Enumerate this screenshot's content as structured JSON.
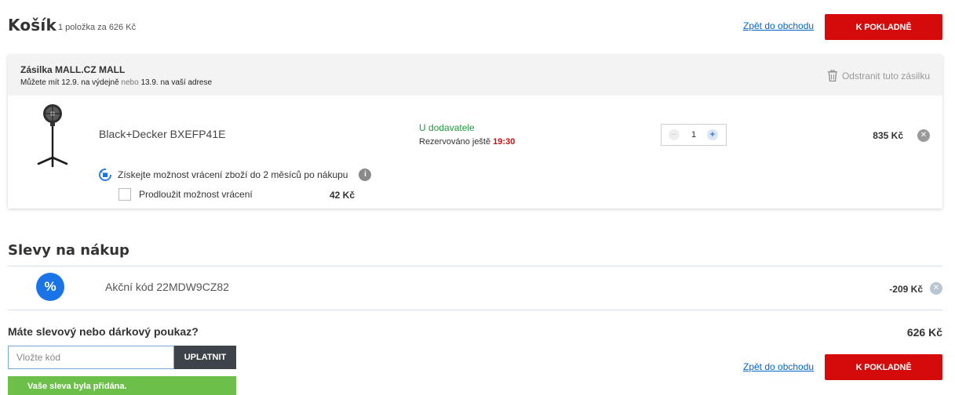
{
  "header": {
    "title": "Košík",
    "summary": "1 položka za 626 Kč",
    "back_link": "Zpět do obchodu",
    "checkout_label": "K POKLADNĚ"
  },
  "shipment": {
    "title": "Zásilka MALL.CZ MALL",
    "delivery_prefix": "Můžete mít 12.9. na výdejně",
    "delivery_or": "nebo",
    "delivery_suffix": "13.9. na vaší adrese",
    "remove_label": "Odstranit tuto zásilku",
    "icons": {
      "remove": "trash-icon"
    }
  },
  "item": {
    "name": "Black+Decker BXEFP41E",
    "stock_status": "U dodavatele",
    "reserved_label": "Rezervováno ještě",
    "reserved_time": "19:30",
    "quantity": "1",
    "minus_symbol": "−",
    "plus_symbol": "+",
    "price": "835 Kč",
    "remove_symbol": "✕",
    "return_text": "Získejte možnost vrácení zboží do 2 měsíců po nákupu",
    "info_symbol": "i",
    "extend_label": "Prodloužit možnost vrácení",
    "extend_price": "42 Kč",
    "colors": {
      "stock": "#1e9b3a",
      "time": "#d50a0a"
    }
  },
  "discounts": {
    "title": "Slevy na nákup",
    "promo_symbol": "%",
    "promo_label": "Akční kód 22MDW9CZ82",
    "promo_value": "-209 Kč",
    "remove_symbol": "✕"
  },
  "voucher": {
    "question": "Máte slevový nebo dárkový poukaz?",
    "placeholder": "Vložte kód",
    "apply_label": "UPLATNIT",
    "success": "Vaše sleva byla přidána."
  },
  "footer": {
    "total": "626 Kč",
    "back_link": "Zpět do obchodu",
    "checkout_label": "K POKLADNĚ"
  },
  "colors": {
    "accent": "#d50a0a",
    "link": "#0066cc",
    "promo": "#1a74e8",
    "success": "#6cc04a"
  }
}
